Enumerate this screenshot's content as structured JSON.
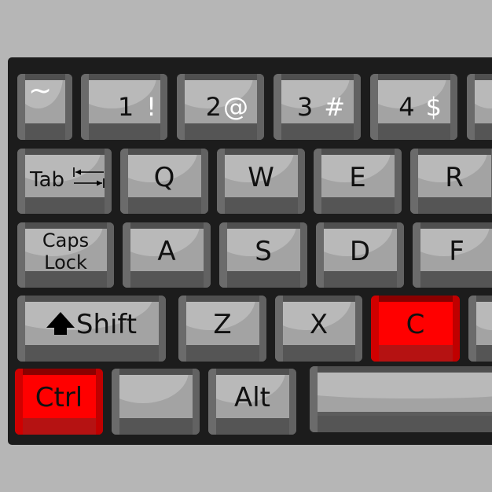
{
  "image": {
    "subject": "Keyboard close-up with Ctrl and C keys highlighted",
    "highlight_color": "#ff0000"
  },
  "rows": {
    "row1": {
      "tilde": {
        "label": "~"
      },
      "one": {
        "primary": "1",
        "secondary": "!"
      },
      "two": {
        "primary": "2",
        "secondary": "@"
      },
      "three": {
        "primary": "3",
        "secondary": "#"
      },
      "four": {
        "primary": "4",
        "secondary": "$"
      }
    },
    "row2": {
      "tab": {
        "label": "Tab"
      },
      "q": {
        "label": "Q"
      },
      "w": {
        "label": "W"
      },
      "e": {
        "label": "E"
      },
      "r": {
        "label": "R"
      }
    },
    "row3": {
      "caps": {
        "line1": "Caps",
        "line2": "Lock"
      },
      "a": {
        "label": "A"
      },
      "s": {
        "label": "S"
      },
      "d": {
        "label": "D"
      },
      "f": {
        "label": "F"
      }
    },
    "row4": {
      "shift": {
        "label": "Shift"
      },
      "z": {
        "label": "Z"
      },
      "x": {
        "label": "X"
      },
      "c": {
        "label": "C",
        "highlighted": true
      }
    },
    "row5": {
      "ctrl": {
        "label": "Ctrl",
        "highlighted": true
      },
      "blank": {
        "label": ""
      },
      "alt": {
        "label": "Alt"
      },
      "space": {
        "label": ""
      }
    }
  }
}
